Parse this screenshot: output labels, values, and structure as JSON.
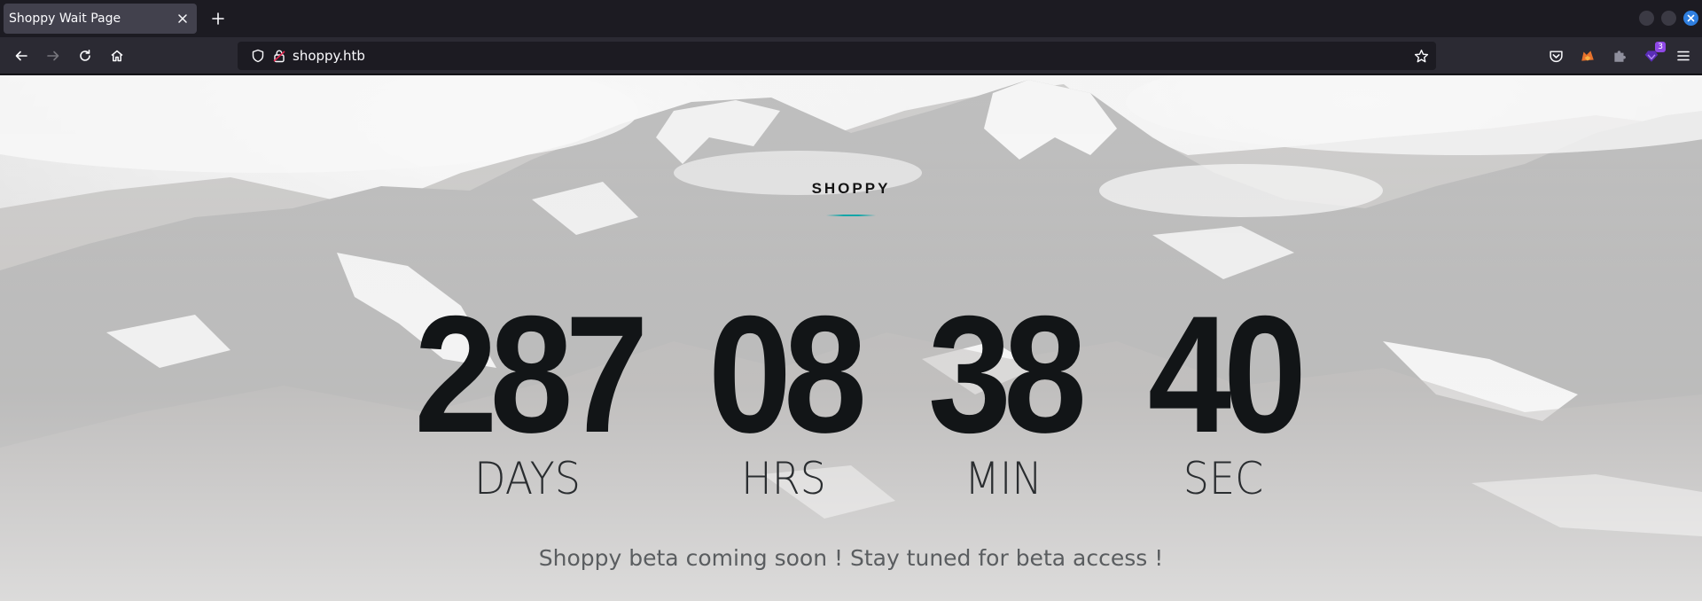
{
  "browser": {
    "tab": {
      "title": "Shoppy Wait Page"
    },
    "url": "shoppy.htb",
    "extension_badge": "3"
  },
  "page": {
    "brand": "SHOPPY",
    "countdown": [
      {
        "value": "287",
        "label": "DAYS"
      },
      {
        "value": "08",
        "label": "HRS"
      },
      {
        "value": "38",
        "label": "MIN"
      },
      {
        "value": "40",
        "label": "SEC"
      }
    ],
    "tagline": "Shoppy beta coming soon ! Stay tuned for beta access !"
  },
  "colors": {
    "accent_line": "#12a6a8",
    "counter_text": "#121517",
    "browser_chrome": "#2b2a33"
  }
}
